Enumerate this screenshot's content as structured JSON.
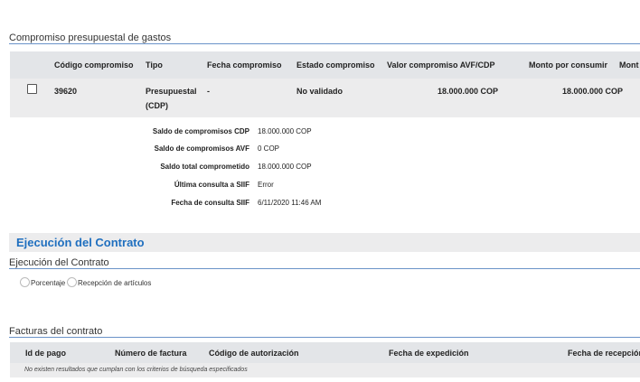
{
  "compromiso": {
    "title": "Compromiso presupuestal de gastos",
    "columns": [
      "Código compromiso",
      "Tipo",
      "Fecha compromiso",
      "Estado compromiso",
      "Valor compromiso AVF/CDP",
      "Monto por consumir",
      "Mont"
    ],
    "row": {
      "codigo": "39620",
      "tipo_line1": "Presupuestal",
      "tipo_line2": "(CDP)",
      "fecha": "-",
      "estado": "No validado",
      "valor": "18.000.000 COP",
      "monto": "18.000.000 COP"
    },
    "summary": [
      {
        "label": "Saldo de compromisos CDP",
        "value": "18.000.000 COP"
      },
      {
        "label": "Saldo de compromisos AVF",
        "value": "0 COP"
      },
      {
        "label": "Saldo total comprometido",
        "value": "18.000.000 COP"
      },
      {
        "label": "Última consulta a SIIF",
        "value": "Error"
      },
      {
        "label": "Fecha de consulta SIIF",
        "value": "6/11/2020 11:46 AM"
      }
    ]
  },
  "ejecucion": {
    "band_title": "Ejecución del Contrato",
    "section_title": "Ejecución del Contrato",
    "options": [
      "Porcentaje",
      "Recepción de artículos"
    ]
  },
  "facturas": {
    "title": "Facturas del contrato",
    "columns": [
      "Id de pago",
      "Número de factura",
      "Código de autorización",
      "Fecha de expedición",
      "Fecha de recepción"
    ],
    "empty_text": "No existen resultados que cumplan con los criterios de búsqueda especificados"
  }
}
